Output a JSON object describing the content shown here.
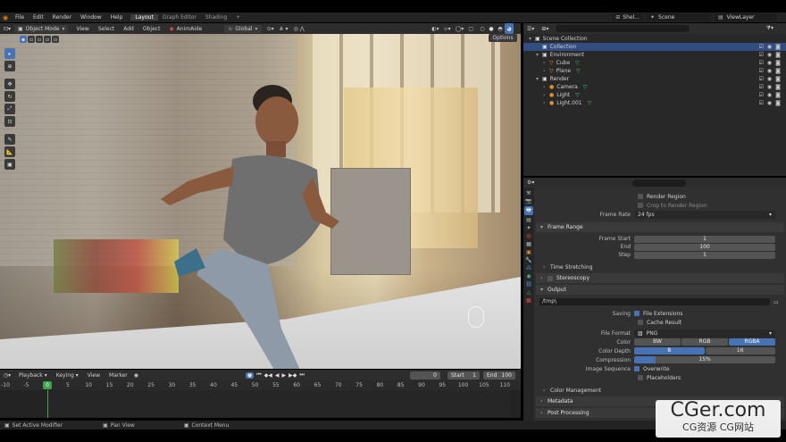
{
  "topbar": {
    "menus": [
      "File",
      "Edit",
      "Render",
      "Window",
      "Help"
    ],
    "workspaces": [
      "Layout",
      "Graph Editor",
      "Shading"
    ],
    "add_tab": "+",
    "scene_selector": "Shel...",
    "scene_name": "Scene",
    "view_layer": "ViewLayer"
  },
  "viewport_header": {
    "mode": "Object Mode",
    "menus": [
      "View",
      "Select",
      "Add",
      "Object",
      "AnimAide"
    ],
    "orientation": "Global",
    "options_label": "Options"
  },
  "outliner": {
    "rows": [
      {
        "label": "Scene Collection",
        "depth": 0
      },
      {
        "label": "Collection",
        "depth": 1
      },
      {
        "label": "Environment",
        "depth": 1
      },
      {
        "label": "Cube",
        "depth": 2
      },
      {
        "label": "Plane",
        "depth": 2
      },
      {
        "label": "Render",
        "depth": 1
      },
      {
        "label": "Camera",
        "depth": 2
      },
      {
        "label": "Light",
        "depth": 2
      },
      {
        "label": "Light.001",
        "depth": 2
      }
    ]
  },
  "properties": {
    "render_region": "Render Region",
    "crop_region": "Crop to Render Region",
    "frame_rate_label": "Frame Rate",
    "frame_rate_value": "24 fps",
    "frame_range_title": "Frame Range",
    "frame_start_label": "Frame Start",
    "frame_start_value": "1",
    "end_label": "End",
    "end_value": "100",
    "step_label": "Step",
    "step_value": "1",
    "time_stretching": "Time Stretching",
    "stereoscopy": "Stereoscopy",
    "output_title": "Output",
    "output_path": "/tmp\\",
    "saving_label": "Saving",
    "file_extensions": "File Extensions",
    "cache_result": "Cache Result",
    "file_format_label": "File Format",
    "file_format_value": "PNG",
    "color_label": "Color",
    "color_options": [
      "BW",
      "RGB",
      "RGBA"
    ],
    "color_depth_label": "Color Depth",
    "color_depth_options": [
      "8",
      "16"
    ],
    "compression_label": "Compression",
    "compression_value": "15%",
    "compression_fraction": 0.15,
    "image_sequence_label": "Image Sequence",
    "overwrite": "Overwrite",
    "placeholders": "Placeholders",
    "color_management": "Color Management",
    "metadata": "Metadata",
    "post_processing": "Post Processing"
  },
  "timeline": {
    "menus": [
      "Playback",
      "Keying",
      "View",
      "Marker"
    ],
    "current_frame": "0",
    "start_label": "Start",
    "start_value": "1",
    "end_label": "End",
    "end_value": "100",
    "playhead_frame": "0",
    "ticks": [
      "-10",
      "-5",
      "0",
      "5",
      "10",
      "15",
      "20",
      "25",
      "30",
      "35",
      "40",
      "45",
      "50",
      "55",
      "60",
      "65",
      "70",
      "75",
      "80",
      "85",
      "90",
      "95",
      "100",
      "105",
      "110"
    ]
  },
  "statusbar": {
    "items": [
      "Set Active Modifier",
      "Pan View",
      "Context Menu"
    ]
  },
  "watermark": {
    "main": "CGer.com",
    "sub": "CG资源 CG网站"
  },
  "colors": {
    "accent": "#4772b3",
    "panel_bg": "#303030",
    "header_bg": "#2a2a2a",
    "playhead": "#3fa34d"
  }
}
